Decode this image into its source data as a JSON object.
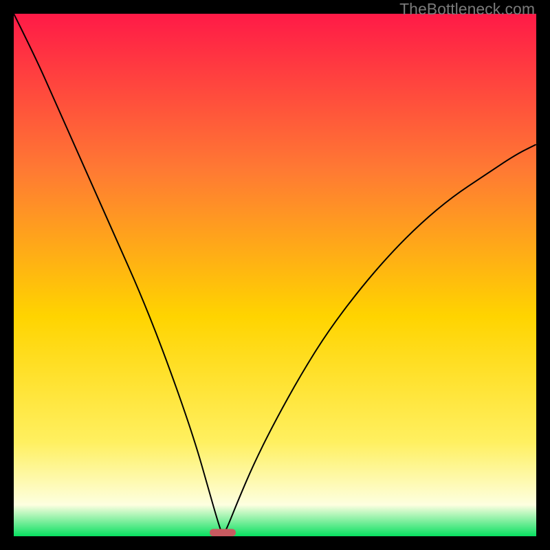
{
  "watermark": "TheBottleneck.com",
  "colors": {
    "gradient_top": "#ff1a47",
    "gradient_mid_upper": "#ff7a33",
    "gradient_mid": "#ffd400",
    "gradient_mid_lower": "#fff060",
    "gradient_pale": "#fdffe0",
    "gradient_bottom": "#08e060",
    "curve": "#000000",
    "marker_fill": "#c85a60",
    "marker_stroke": "#c85a60",
    "frame": "#000000"
  },
  "chart_data": {
    "type": "line",
    "title": "",
    "xlabel": "",
    "ylabel": "",
    "xlim": [
      0,
      100
    ],
    "ylim": [
      0,
      100
    ],
    "notes": "V-shaped bottleneck curve on a red→yellow→green vertical gradient. Curve minimum (≈0) occurs near x≈40. Background hue encodes the same y-value scale (red=high, green=low). A small rounded marker sits at the minimum on the x-axis.",
    "series": [
      {
        "name": "bottleneck-curve",
        "x": [
          0,
          4,
          8,
          12,
          16,
          20,
          24,
          28,
          32,
          35,
          37,
          39,
          40,
          41,
          43,
          46,
          50,
          55,
          60,
          66,
          72,
          78,
          84,
          90,
          96,
          100
        ],
        "y": [
          100,
          92,
          83,
          74,
          65,
          56,
          47,
          37,
          26,
          17,
          10,
          3,
          0,
          2,
          7,
          14,
          22,
          31,
          39,
          47,
          54,
          60,
          65,
          69,
          73,
          75
        ]
      }
    ],
    "marker": {
      "x": 40,
      "y": 0,
      "width": 5,
      "height": 1.4
    }
  }
}
